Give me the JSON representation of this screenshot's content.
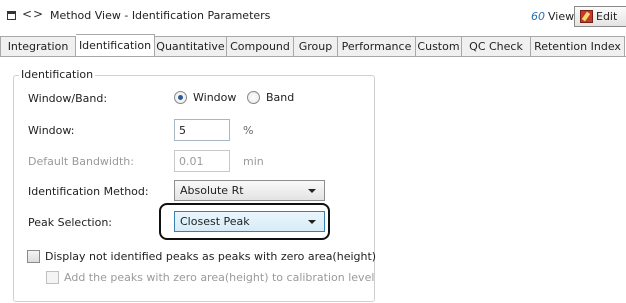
{
  "window": {
    "title": "Method View - Identification Parameters",
    "nav_glyph": "<>",
    "view_label": "View",
    "edit_label": "Edit"
  },
  "tabs": [
    {
      "label": "Integration",
      "active": false
    },
    {
      "label": "Identification",
      "active": true
    },
    {
      "label": "Quantitative",
      "active": false
    },
    {
      "label": "Compound",
      "active": false
    },
    {
      "label": "Group",
      "active": false
    },
    {
      "label": "Performance",
      "active": false
    },
    {
      "label": "Custom",
      "active": false
    },
    {
      "label": "QC Check",
      "active": false
    },
    {
      "label": "Retention Index",
      "active": false
    }
  ],
  "group": {
    "legend": "Identification",
    "window_band_label": "Window/Band:",
    "radio_window": "Window",
    "radio_band": "Band",
    "selected_radio": "Window",
    "window_label": "Window:",
    "window_value": "5",
    "window_unit": "%",
    "default_bandwidth_label": "Default Bandwidth:",
    "default_bandwidth_value": "0.01",
    "default_bandwidth_unit": "min",
    "identification_method_label": "Identification Method:",
    "identification_method_value": "Absolute Rt",
    "peak_selection_label": "Peak Selection:",
    "peak_selection_value": "Closest Peak",
    "display_not_identified_label": "Display not identified peaks as peaks with zero area(height)",
    "display_not_identified_checked": false,
    "add_peaks_label": "Add the peaks with zero area(height) to calibration level",
    "add_peaks_checked": false
  },
  "colors": {
    "accent": "#3c7fb1",
    "highlight_ring": "#111111",
    "disabled_text": "#9a9a9a"
  }
}
